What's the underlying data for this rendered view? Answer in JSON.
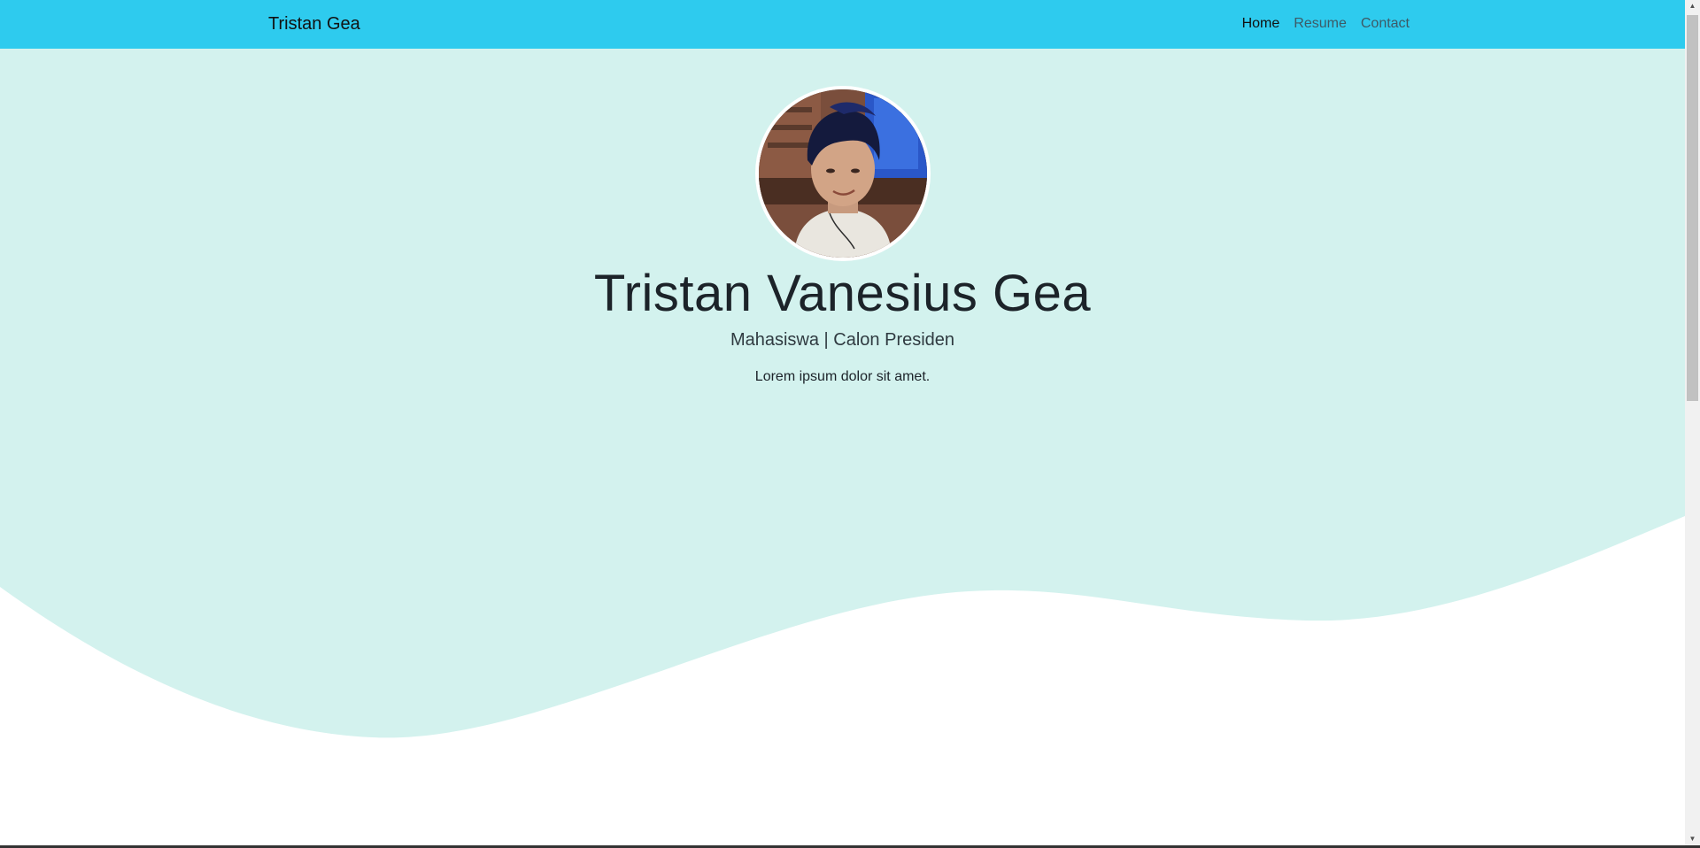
{
  "navbar": {
    "brand": "Tristan Gea",
    "links": [
      {
        "label": "Home",
        "active": true
      },
      {
        "label": "Resume",
        "active": false
      },
      {
        "label": "Contact",
        "active": false
      }
    ]
  },
  "hero": {
    "name": "Tristan Vanesius Gea",
    "subtitle": "Mahasiswa | Calon Presiden",
    "tagline": "Lorem ipsum dolor sit amet."
  },
  "colors": {
    "navbar": "#2ecbee",
    "hero_bg": "#d3f2ee",
    "page_bg": "#ffffff"
  },
  "icons": {
    "scroll_up": "scroll-up-arrow",
    "scroll_down": "scroll-down-arrow"
  }
}
